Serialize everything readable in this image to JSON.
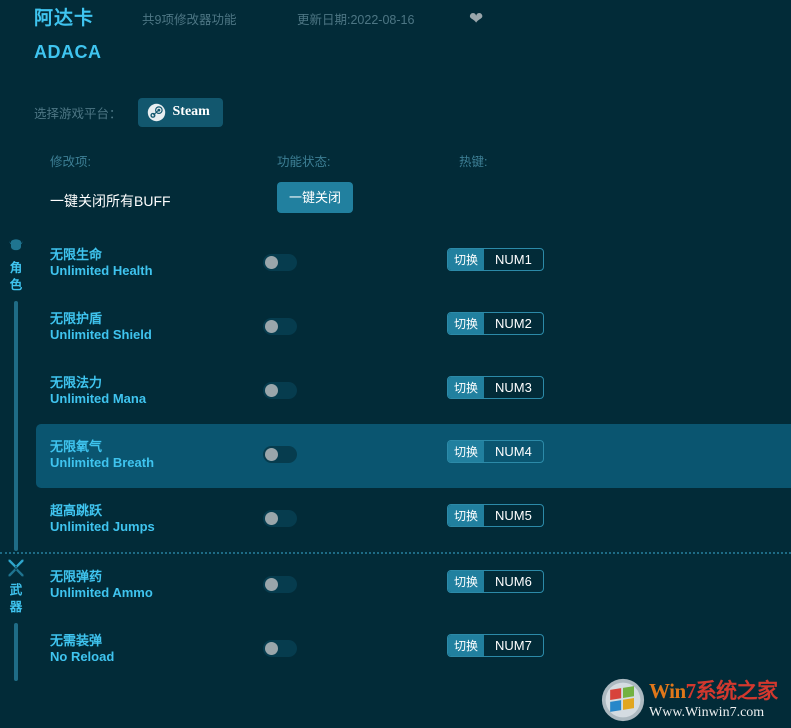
{
  "header": {
    "game_title_cn": "阿达卡",
    "game_title_en": "ADACA",
    "feature_count": "共9项修改器功能",
    "update_date": "更新日期:2022-08-16",
    "favorite_icon": "heart-icon"
  },
  "platform": {
    "label": "选择游戏平台：",
    "selected": "Steam",
    "icon": "steam-icon"
  },
  "columns": {
    "name": "修改项:",
    "status": "功能状态:",
    "hotkey": "热键:"
  },
  "global_action": {
    "label": "一键关闭所有BUFF",
    "button": "一键关闭"
  },
  "sections": [
    {
      "id": "character",
      "icon": "helmet-icon",
      "title": "角色",
      "rows": [
        {
          "name_cn": "无限生命",
          "name_en": "Unlimited Health",
          "toggle_state": "off",
          "hotkey_action": "切换",
          "hotkey_key": "NUM1",
          "highlighted": false
        },
        {
          "name_cn": "无限护盾",
          "name_en": "Unlimited Shield",
          "toggle_state": "off",
          "hotkey_action": "切换",
          "hotkey_key": "NUM2",
          "highlighted": false
        },
        {
          "name_cn": "无限法力",
          "name_en": "Unlimited Mana",
          "toggle_state": "off",
          "hotkey_action": "切换",
          "hotkey_key": "NUM3",
          "highlighted": false
        },
        {
          "name_cn": "无限氧气",
          "name_en": "Unlimited Breath",
          "toggle_state": "off",
          "hotkey_action": "切换",
          "hotkey_key": "NUM4",
          "highlighted": true
        },
        {
          "name_cn": "超高跳跃",
          "name_en": "Unlimited Jumps",
          "toggle_state": "off",
          "hotkey_action": "切换",
          "hotkey_key": "NUM5",
          "highlighted": false
        }
      ]
    },
    {
      "id": "weapons",
      "icon": "crossed-swords-icon",
      "title": "武器",
      "rows": [
        {
          "name_cn": "无限弹药",
          "name_en": "Unlimited Ammo",
          "toggle_state": "off",
          "hotkey_action": "切换",
          "hotkey_key": "NUM6",
          "highlighted": false
        },
        {
          "name_cn": "无需装弹",
          "name_en": "No Reload",
          "toggle_state": "off",
          "hotkey_action": "切换",
          "hotkey_key": "NUM7",
          "highlighted": false
        }
      ]
    }
  ],
  "watermark": {
    "brand_win": "Win",
    "brand_7": "7",
    "brand_cn": "系统之家",
    "url": "Www.Winwin7.com"
  },
  "colors": {
    "background": "#022b38",
    "accent": "#3fc4ef",
    "button": "#21809f",
    "highlight_row": "#0a5570",
    "muted": "#4d7684"
  }
}
